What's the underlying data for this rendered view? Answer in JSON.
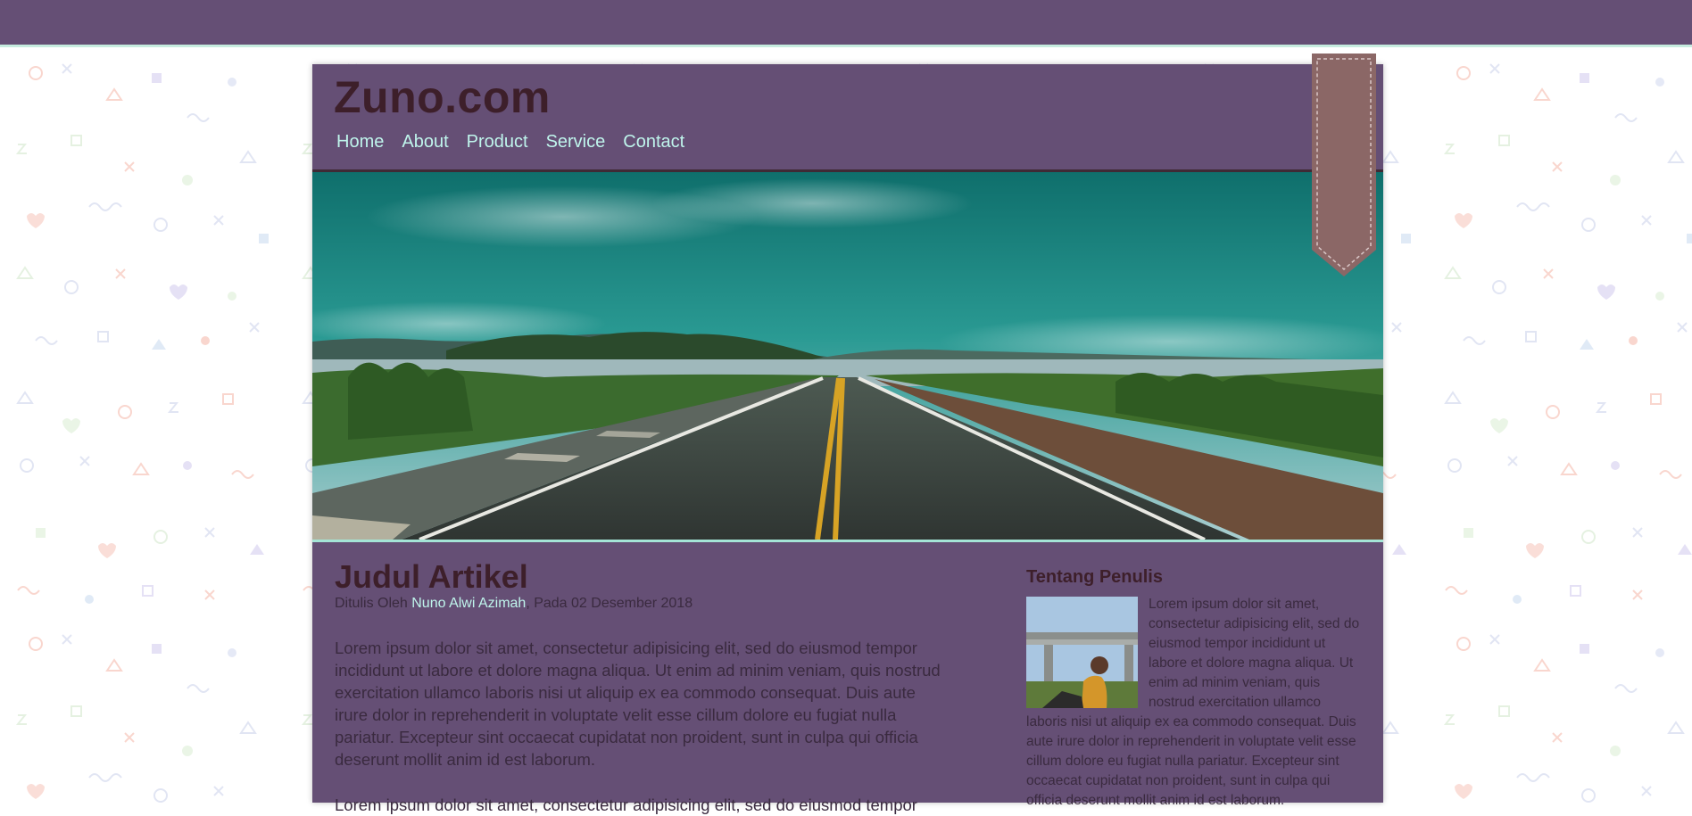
{
  "site": {
    "title": "Zuno.com",
    "nav": [
      "Home",
      "About",
      "Product",
      "Service",
      "Contact"
    ]
  },
  "colors": {
    "topbar": "#654f75",
    "accent": "#c6ecdf",
    "title": "#3d1f2a",
    "ribbon": "#8b6766",
    "link": "#bff5ec"
  },
  "hero": {
    "image": "road-landscape-photo"
  },
  "article": {
    "title": "Judul Artikel",
    "meta_prefix": "Ditulis Oleh ",
    "author": "Nuno Alwi Azimah",
    "meta_suffix": ", Pada 02 Desember 2018",
    "paragraphs": [
      "Lorem ipsum dolor sit amet, consectetur adipisicing elit, sed do eiusmod tempor incididunt ut labore et dolore magna aliqua. Ut enim ad minim veniam, quis nostrud exercitation ullamco laboris nisi ut aliquip ex ea commodo consequat. Duis aute irure dolor in reprehenderit in voluptate velit esse cillum dolore eu fugiat nulla pariatur. Excepteur sint occaecat cupidatat non proident, sunt in culpa qui officia deserunt mollit anim id est laborum.",
      "Lorem ipsum dolor sit amet, consectetur adipisicing elit, sed do eiusmod tempor"
    ]
  },
  "sidebar": {
    "heading": "Tentang Penulis",
    "text": "Lorem ipsum dolor sit amet, consectetur adipisicing elit, sed do eiusmod tempor incididunt ut labore et dolore magna aliqua. Ut enim ad minim veniam, quis nostrud exercitation ullamco laboris nisi ut aliquip ex ea commodo consequat. Duis aute irure dolor in reprehenderit in voluptate velit esse cillum dolore eu fugiat nulla pariatur. Excepteur sint occaecat cupidatat non proident, sunt in culpa qui officia deserunt mollit anim id est laborum.",
    "photo": "author-photo"
  }
}
